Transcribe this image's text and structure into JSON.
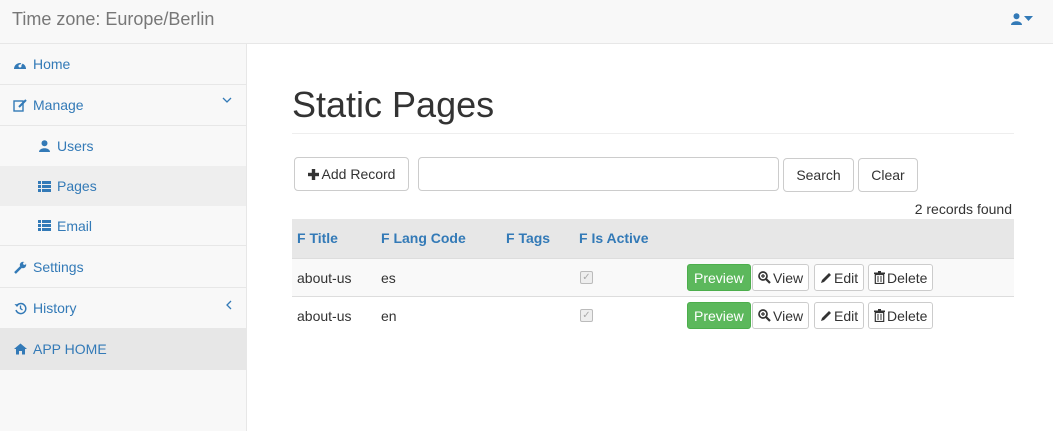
{
  "navbar": {
    "brand": "Time zone: Europe/Berlin",
    "user_icon": "user-icon"
  },
  "sidebar": {
    "items": [
      {
        "label": "Home",
        "icon": "dashboard-icon"
      },
      {
        "label": "Manage",
        "icon": "edit-icon",
        "caret": "chevron-down-icon"
      },
      {
        "label": "Users",
        "icon": "user-icon"
      },
      {
        "label": "Pages",
        "icon": "list-icon"
      },
      {
        "label": "Email",
        "icon": "list-icon"
      },
      {
        "label": "Settings",
        "icon": "wrench-icon"
      },
      {
        "label": "History",
        "icon": "history-icon",
        "caret": "chevron-left-icon"
      },
      {
        "label": "APP HOME",
        "icon": "home-icon"
      }
    ]
  },
  "main": {
    "title": "Static Pages",
    "toolbar": {
      "add_label": "Add Record",
      "search_value": "",
      "search_label": "Search",
      "clear_label": "Clear"
    },
    "records_found": "2 records found",
    "table": {
      "headers": [
        "F Title",
        "F Lang Code",
        "F Tags",
        "F Is Active"
      ],
      "rows": [
        {
          "title": "about-us",
          "lang": "es",
          "tags": "",
          "active": true
        },
        {
          "title": "about-us",
          "lang": "en",
          "tags": "",
          "active": true
        }
      ],
      "actions": {
        "preview": "Preview",
        "view": "View",
        "edit": "Edit",
        "delete": "Delete"
      }
    }
  },
  "colors": {
    "link": "#337ab7",
    "preview_btn": "#5cb85c"
  }
}
